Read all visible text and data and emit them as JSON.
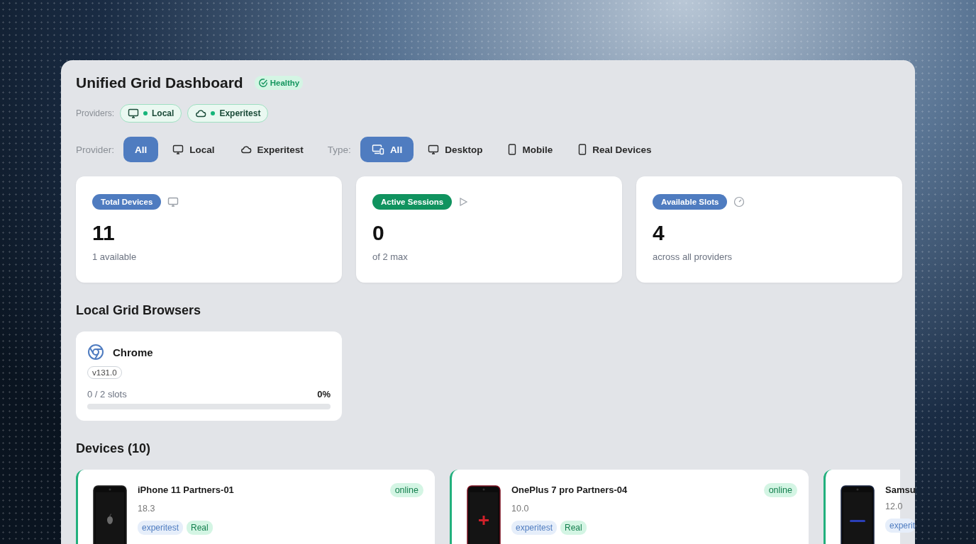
{
  "header": {
    "title": "Unified Grid Dashboard",
    "status": "Healthy"
  },
  "providers": {
    "label": "Providers:",
    "items": [
      {
        "label": "Local",
        "kind": "local",
        "online": true
      },
      {
        "label": "Experitest",
        "kind": "cloud",
        "online": true
      }
    ]
  },
  "filters": [
    {
      "label": "Provider:",
      "options": [
        {
          "label": "All",
          "kind": "any",
          "selected": true
        },
        {
          "label": "Local",
          "kind": "local",
          "selected": false
        },
        {
          "label": "Experitest",
          "kind": "cloud",
          "selected": false
        }
      ]
    },
    {
      "label": "Type:",
      "options": [
        {
          "label": "All",
          "kind": "any",
          "selected": true
        },
        {
          "label": "Desktop",
          "kind": "desktop",
          "selected": false
        },
        {
          "label": "Mobile",
          "kind": "mobile",
          "selected": false
        },
        {
          "label": "Real Devices",
          "kind": "real",
          "selected": false
        }
      ]
    }
  ],
  "stats": [
    {
      "badge": "Total Devices",
      "color": "#4f7cc0",
      "kind": "devices",
      "value": "11",
      "note": "1 available"
    },
    {
      "badge": "Active Sessions",
      "color": "#10935f",
      "kind": "sessions",
      "value": "0",
      "note": "of 2 max"
    },
    {
      "badge": "Available Slots",
      "color": "#4f7cc0",
      "kind": "slots",
      "value": "4",
      "note": "across all providers"
    }
  ],
  "browsers": {
    "title": "Local Grid Browsers",
    "items": [
      {
        "name": "Chrome",
        "version": "v131.0",
        "slots": "0 / 2 slots",
        "percent": "0%",
        "level": 0
      }
    ]
  },
  "devices": {
    "title": "Devices (10)",
    "items": [
      {
        "name": "iPhone 11 Partners-01",
        "version": "18.3",
        "status": "online",
        "kind": "apple",
        "tags": [
          {
            "label": "experitest",
            "kind": "provider"
          },
          {
            "label": "Real",
            "kind": "type"
          }
        ]
      },
      {
        "name": "OnePlus 7 pro Partners-04",
        "version": "10.0",
        "status": "online",
        "kind": "oneplus",
        "tags": [
          {
            "label": "experitest",
            "kind": "provider"
          },
          {
            "label": "Real",
            "kind": "type"
          }
        ]
      },
      {
        "name": "Samsu",
        "version": "12.0",
        "kind": "samsung",
        "tags": [
          {
            "label": "experit",
            "kind": "provider"
          }
        ]
      }
    ]
  }
}
